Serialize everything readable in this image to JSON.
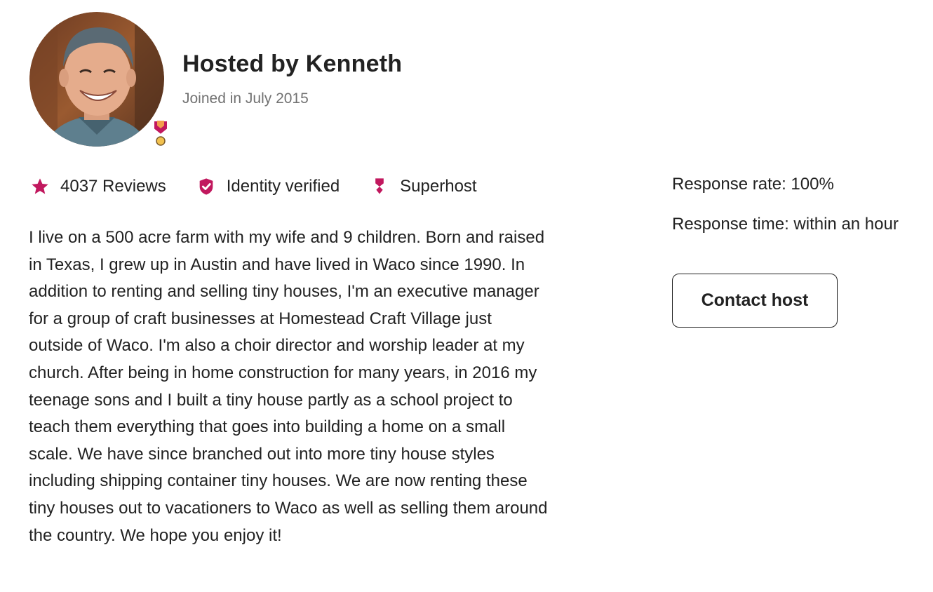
{
  "host": {
    "title": "Hosted by Kenneth",
    "joined": "Joined in July 2015"
  },
  "stats": {
    "reviews": {
      "label": "4037 Reviews",
      "icon": "star-icon"
    },
    "identity": {
      "label": "Identity verified",
      "icon": "shield-check-icon"
    },
    "superhost": {
      "label": "Superhost",
      "icon": "superhost-medal-icon"
    }
  },
  "bio": "I live on a 500 acre farm with my wife and 9 children. Born and raised in Texas, I grew up in Austin and have lived in Waco since 1990. In addition to renting and selling tiny houses, I'm an executive manager for a group of craft businesses at Homestead Craft Village just outside of Waco. I'm also a choir director and worship leader at my church. After being in home construction for many years, in 2016 my teenage sons and I built a tiny house partly as a school project to teach them everything that goes into building a home on a small scale. We have since branched out into more tiny house styles including shipping container tiny houses. We are now renting these tiny houses out to vacationers to Waco as well as selling them around the country. We hope you enjoy it!",
  "response": {
    "rate": "Response rate: 100%",
    "time": "Response time: within an hour"
  },
  "contact_button": {
    "label": "Contact host"
  },
  "colors": {
    "accent": "#C1185E",
    "text": "#222222",
    "muted": "#717171"
  }
}
